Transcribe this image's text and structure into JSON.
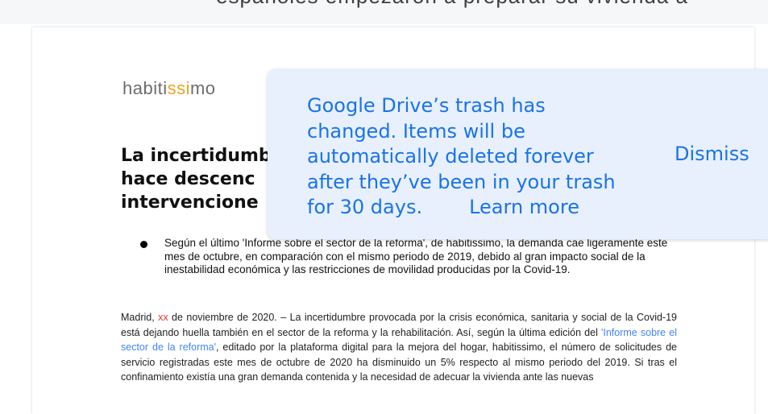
{
  "background_text": "españoles empezaron a preparar su vivienda a",
  "document": {
    "logo": {
      "part1": "habiti",
      "highlight": "ssi",
      "part2": "mo"
    },
    "title_lines": [
      "La incertidumbre",
      "hace descenc",
      "intervencione"
    ],
    "bullet": "Según el último 'Informe sobre el sector de la reforma', de habitissimo, la demanda cae ligeramente este mes de octubre, en comparación con el mismo periodo de 2019, debido al gran impacto social de la inestabilidad económica y las restricciones de movilidad producidas por la Covid-19.",
    "paragraph": {
      "lead": "Madrid, ",
      "date_placeholder": "xx",
      "text1": " de noviembre de 2020. – La incertidumbre provocada por la crisis económica, sanitaria y social de la Covid-19 está dejando huella también en el sector de la reforma y la rehabilitación. Así, según la última edición del ",
      "link": "'Informe sobre el sector de la reforma'",
      "text2": ", editado por la plataforma digital para la mejora del hogar, habitissimo, el número de solicitudes de servicio registradas este mes de octubre de 2020 ha disminuido un 5% respecto al mismo periodo del 2019. Si tras el confinamiento existía una gran demanda contenida y la necesidad de adecuar la vivienda ante las nuevas"
    }
  },
  "toast": {
    "message_lines": [
      "Google Drive’s trash has",
      "changed. Items will be",
      "automatically deleted forever",
      "after they’ve been in your trash"
    ],
    "last_line": "for 30 days.",
    "learn_more": "Learn more",
    "dismiss": "Dismiss"
  },
  "colors": {
    "accent": "#1a73e8",
    "toast_bg": "#e8f0fe",
    "logo_highlight": "#f3a11c"
  }
}
